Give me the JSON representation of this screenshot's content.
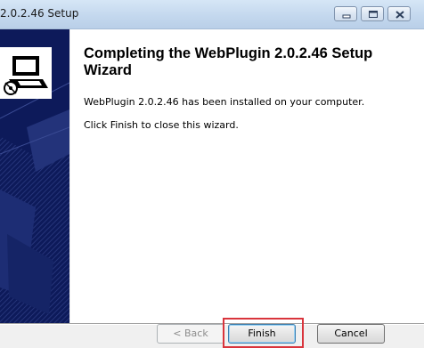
{
  "window": {
    "title": "2.0.2.46 Setup"
  },
  "content": {
    "heading": "Completing the WebPlugin 2.0.2.46 Setup Wizard",
    "installed_message": "WebPlugin 2.0.2.46 has been installed on your computer.",
    "finish_message": "Click Finish to close this wizard."
  },
  "buttons": {
    "back_label": "< Back",
    "finish_label": "Finish",
    "cancel_label": "Cancel"
  },
  "icons": {
    "minimize": "minimize-icon",
    "maximize": "maximize-icon",
    "close": "close-icon",
    "setup": "setup-computer-icon"
  },
  "colors": {
    "banner": "#0d1a5a",
    "highlight": "#d9343c"
  }
}
